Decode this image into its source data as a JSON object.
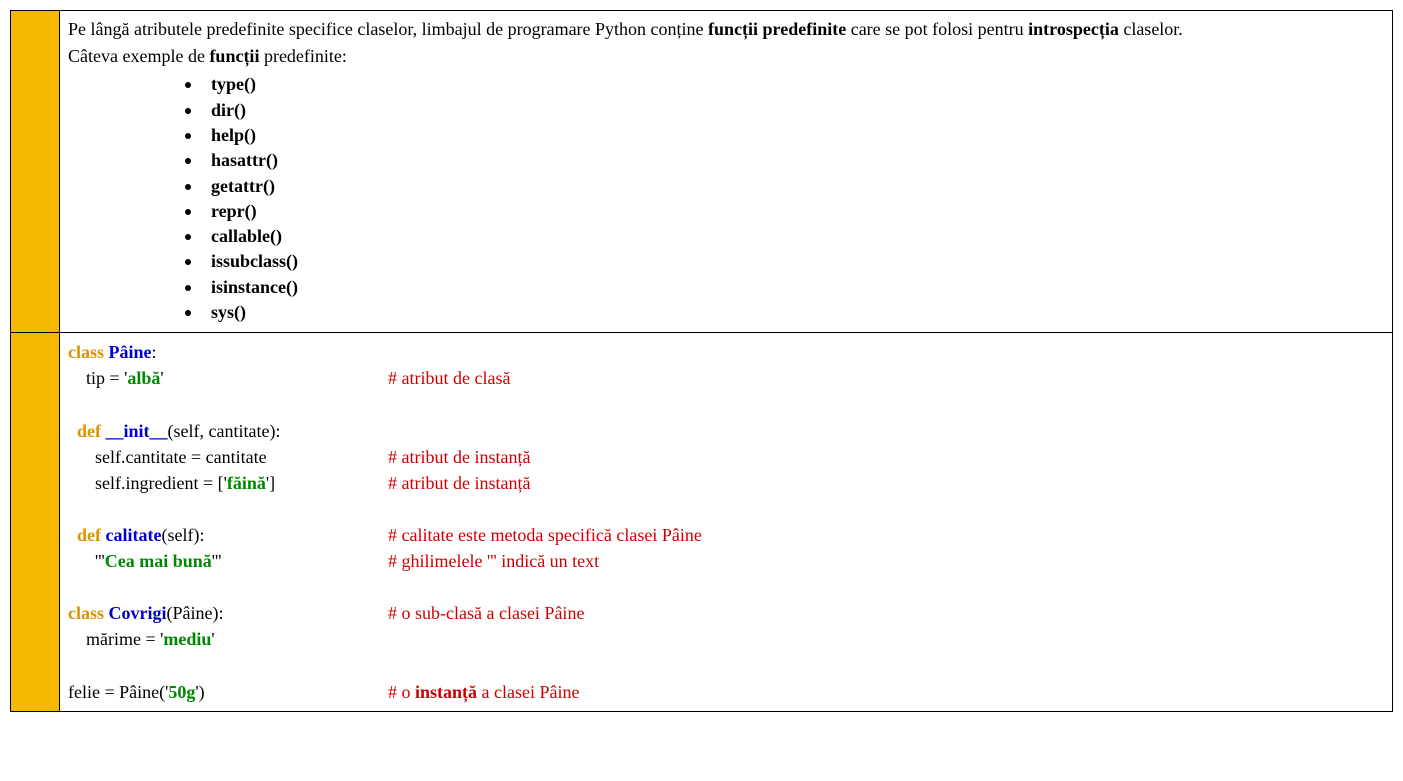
{
  "intro": {
    "p1_pre": "Pe lângă atributele predefinite specifice claselor, limbajul de programare Python conține ",
    "p1_bold": "funcții predefinite",
    "p1_post": " care se pot folosi pentru ",
    "p1_bold2": "introspecția",
    "p1_post2": " claselor.",
    "p2_pre": "Câteva exemple de ",
    "p2_bold": "funcții",
    "p2_post": " predefinite:"
  },
  "funcs": [
    "type()",
    "dir()",
    "help()",
    "hasattr()",
    "getattr()",
    "repr()",
    "callable()",
    "issubclass()",
    "isinstance()",
    "sys()"
  ],
  "code": {
    "l1_kw": "class ",
    "l1_cls": "Pâine",
    "l1_rest": ":",
    "l2_pre": "    tip = '",
    "l2_str": "albă",
    "l2_post": "'",
    "l2_cmt": "# atribut de clasă",
    "l3_kw": "  def ",
    "l3_cls": "__init__",
    "l3_rest": "(self, cantitate):",
    "l4_pre": "      self.cantitate = cantitate",
    "l4_cmt": "# atribut de instanță",
    "l5_pre": "      self.ingredient = ['",
    "l5_str": "făină",
    "l5_post": "']",
    "l5_cmt": "# atribut de instanță",
    "l6_kw": "  def ",
    "l6_cls": "calitate",
    "l6_rest": "(self):",
    "l6_cmt": "# calitate este metoda specifică clasei Pâine",
    "l7_pre": "      '''",
    "l7_str": "Cea mai bună",
    "l7_post": "'''",
    "l7_cmt": "# ghilimelele  '''  indică un text",
    "l8_kw": "class ",
    "l8_cls": "Covrigi",
    "l8_rest": "(Pâine):",
    "l8_cmt": "# o sub-clasă a clasei Pâine",
    "l9_pre": "    mărime = '",
    "l9_str": "mediu",
    "l9_post": "'",
    "l10_pre": "felie = Pâine('",
    "l10_str": "50g",
    "l10_post": "')",
    "l10_cmt_pre": "# o ",
    "l10_cmt_bold": "instanță",
    "l10_cmt_post": " a clasei Pâine"
  }
}
